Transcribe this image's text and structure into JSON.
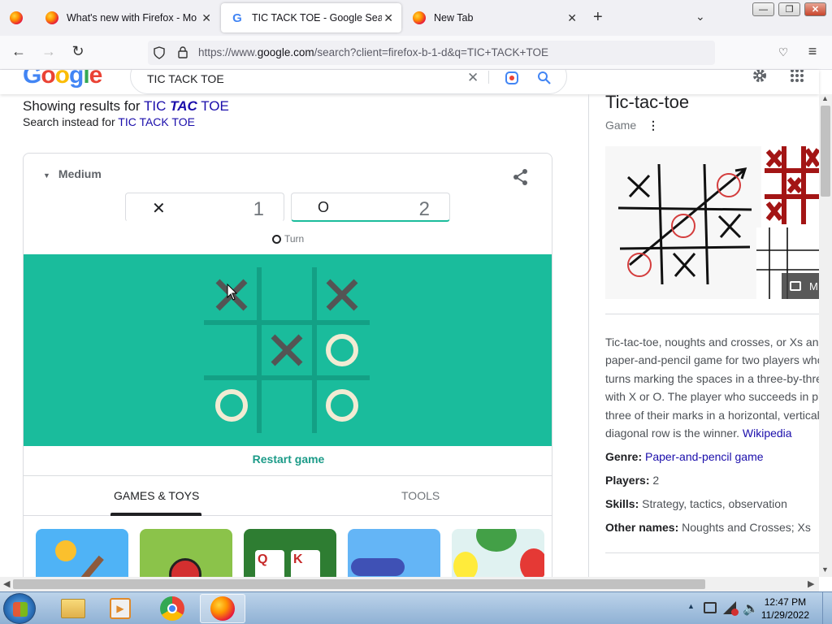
{
  "browser": {
    "tabs": [
      {
        "title": "What's new with Firefox - More",
        "icon": "firefox-icon"
      },
      {
        "title": "TIC TACK TOE - Google Search",
        "icon": "google-icon"
      },
      {
        "title": "New Tab",
        "icon": "firefox-icon"
      }
    ],
    "active_tab": 1,
    "new_tab_symbol": "+",
    "tab_close_symbol": "✕",
    "url_prefix": "https://www.",
    "url_host": "google.com",
    "url_path": "/search?client=firefox-b-1-d&q=TIC+TACK+TOE"
  },
  "google": {
    "logo": "Google",
    "logo_colors": [
      "#4285f4",
      "#ea4335",
      "#fbbc05",
      "#4285f4",
      "#34a853",
      "#ea4335"
    ],
    "query": "TIC TACK TOE"
  },
  "results_for": {
    "label": "Showing results for",
    "word1": "TIC",
    "word2": "TAC",
    "word3": "TOE",
    "instead_label": "Search instead for",
    "instead_query": "TIC TACK TOE"
  },
  "game": {
    "difficulty": "Medium",
    "player_x": {
      "mark": "✕",
      "score": "1"
    },
    "player_o": {
      "mark": "O",
      "score": "2"
    },
    "turn_label": "Turn",
    "board": [
      [
        "X",
        "",
        "X"
      ],
      [
        "",
        "X",
        "O"
      ],
      [
        "O",
        "",
        "O"
      ]
    ],
    "restart_label": "Restart game",
    "tab_games": "GAMES & TOYS",
    "tab_tools": "TOOLS"
  },
  "knowledge_panel": {
    "title": "Tic-tac-toe",
    "subtitle": "Game",
    "more_images": "M",
    "description": [
      "Tic-tac-toe, noughts and crosses, or Xs and",
      "paper-and-pencil game for two players who",
      "turns marking the spaces in a three-by-three",
      "with X or O. The player who succeeds in pla",
      "three of their marks in a horizontal, vertical",
      "diagonal row is the winner."
    ],
    "source": "Wikipedia",
    "facts": [
      {
        "label": "Genre:",
        "value": "Paper-and-pencil game",
        "link": true
      },
      {
        "label": "Players:",
        "value": "2",
        "link": false
      },
      {
        "label": "Skills:",
        "value": "Strategy, tactics, observation",
        "link": false
      },
      {
        "label": "Other names:",
        "value": "Noughts and Crosses; Xs",
        "link": false
      }
    ]
  },
  "taskbar": {
    "time": "12:47 PM",
    "date": "11/29/2022"
  },
  "colors": {
    "board_bg": "#1abc9c",
    "board_lines": "#13a085",
    "x_mark": "#545454",
    "o_mark": "#f2ebd3",
    "link": "#1a0dab",
    "accent_teal": "#1c9b88"
  }
}
